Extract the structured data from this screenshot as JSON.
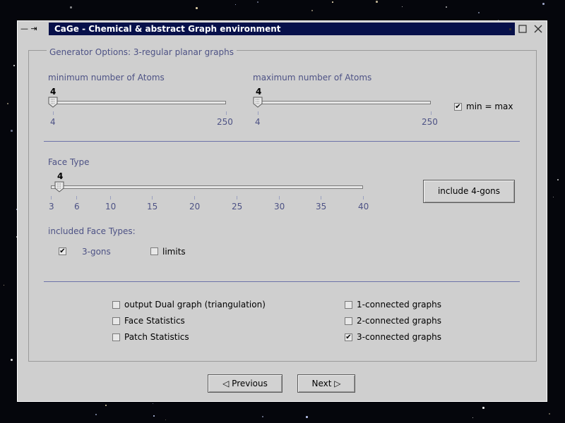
{
  "window": {
    "title": "CaGe - Chemical & abstract Graph environment",
    "left_controls": "— ⇥"
  },
  "group": {
    "title": "Generator Options:  3-regular planar graphs"
  },
  "min_atoms": {
    "label": "minimum number of Atoms",
    "value": "4",
    "min_label": "4",
    "max_label": "250",
    "min": 4,
    "max": 250,
    "current": 4
  },
  "max_atoms": {
    "label": "maximum number of Atoms",
    "value": "4",
    "min_label": "4",
    "max_label": "250",
    "min": 4,
    "max": 250,
    "current": 4
  },
  "min_eq_max": {
    "label": "min = max",
    "checked": true
  },
  "face_type": {
    "label": "Face Type",
    "value": "4",
    "min": 3,
    "max": 40,
    "current": 4,
    "tick_labels": [
      "3",
      "6",
      "10",
      "15",
      "20",
      "25",
      "30",
      "35",
      "40"
    ]
  },
  "include_button": {
    "label": "include 4-gons"
  },
  "included": {
    "label": "included Face Types:",
    "item_label": "3-gons",
    "item_checked": true,
    "limits_label": "limits",
    "limits_checked": false
  },
  "options": {
    "dual": {
      "label": "output Dual graph (triangulation)",
      "checked": false
    },
    "face_stats": {
      "label": "Face Statistics",
      "checked": false
    },
    "patch_stats": {
      "label": "Patch Statistics",
      "checked": false
    },
    "conn1": {
      "label": "1-connected graphs",
      "checked": false
    },
    "conn2": {
      "label": "2-connected graphs",
      "checked": false
    },
    "conn3": {
      "label": "3-connected graphs",
      "checked": true
    }
  },
  "nav": {
    "previous": "Previous",
    "next": "Next",
    "previous_icon": "◁",
    "next_icon": "▷"
  },
  "colors": {
    "window_bg": "#cfcfcf",
    "title_bg": "#07104a",
    "label_blue": "#4d5285"
  }
}
